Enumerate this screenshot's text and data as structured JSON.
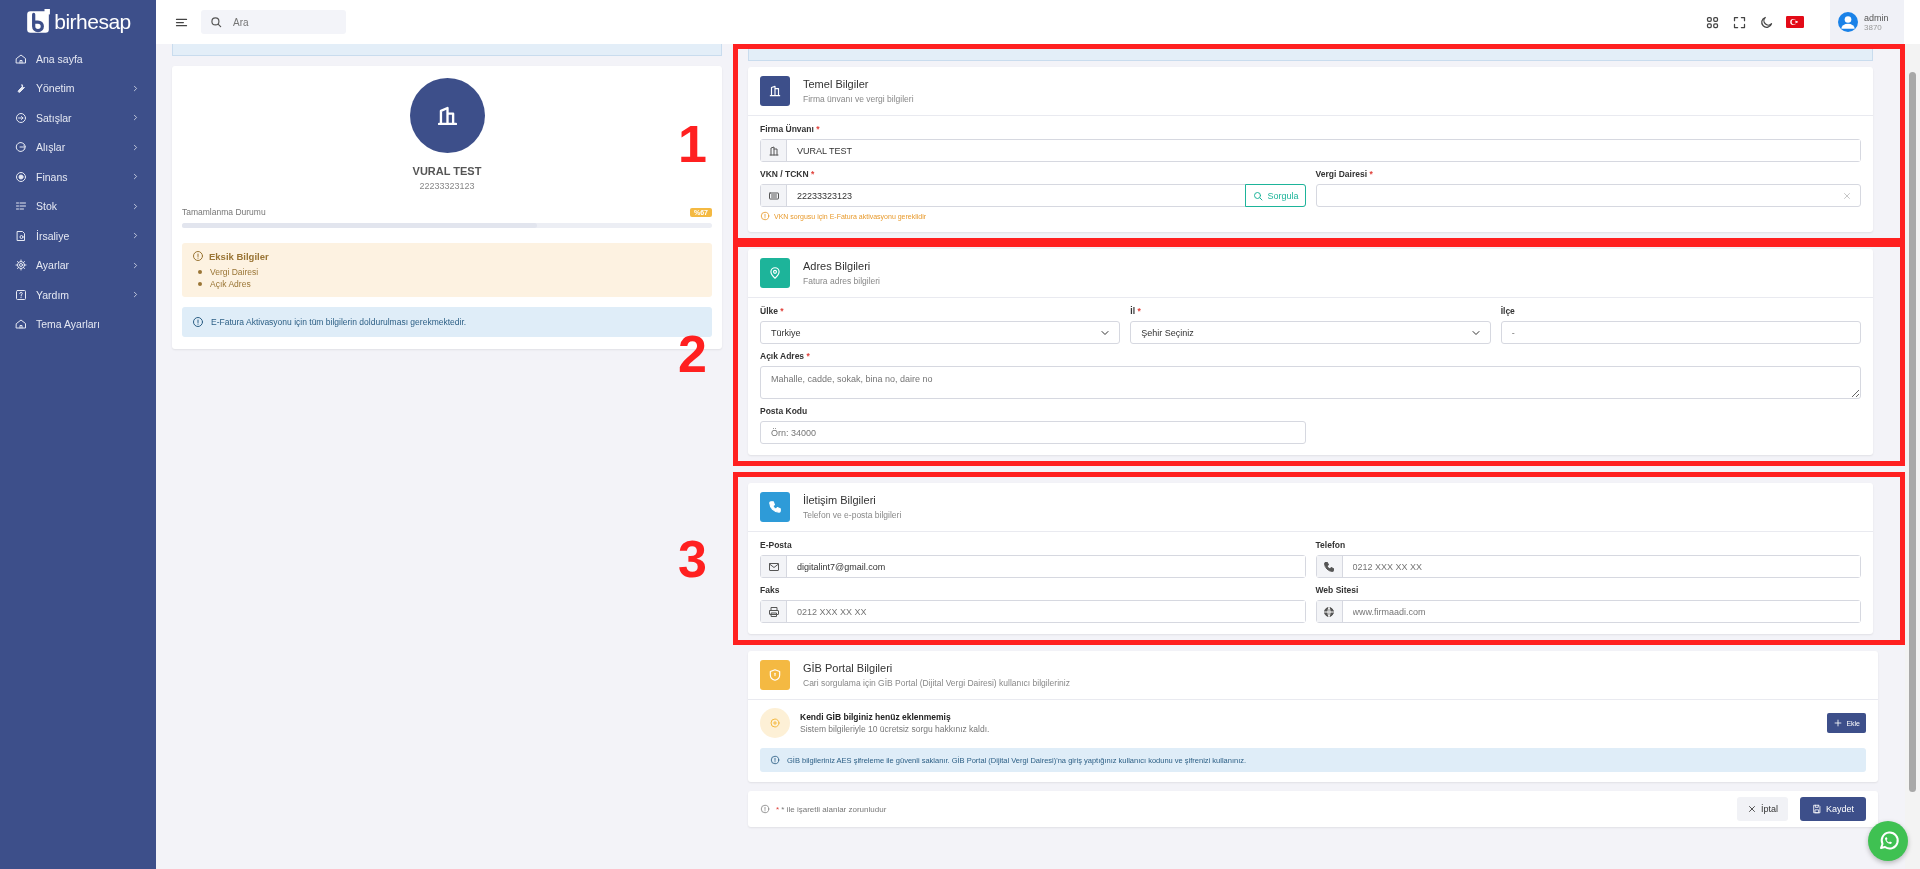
{
  "sidebar": {
    "logo": "birhesap",
    "items": [
      {
        "label": "Ana sayfa",
        "expandable": false
      },
      {
        "label": "Yönetim",
        "expandable": true
      },
      {
        "label": "Satışlar",
        "expandable": true
      },
      {
        "label": "Alışlar",
        "expandable": true
      },
      {
        "label": "Finans",
        "expandable": true
      },
      {
        "label": "Stok",
        "expandable": true
      },
      {
        "label": "İrsaliye",
        "expandable": true
      },
      {
        "label": "Ayarlar",
        "expandable": true
      },
      {
        "label": "Yardım",
        "expandable": true
      },
      {
        "label": "Tema Ayarları",
        "expandable": false
      }
    ]
  },
  "topbar": {
    "search": {
      "placeholder": "Ara"
    },
    "user": {
      "name": "admin",
      "code": "3870"
    }
  },
  "profile": {
    "name": "VURAL TEST",
    "tax_number": "22233323123",
    "completion": {
      "label": "Tamamlanma Durumu",
      "badge": "%67",
      "level": 0.67
    },
    "missing": {
      "title": "Eksik Bilgiler",
      "items": [
        "Vergi Dairesi",
        "Açık Adres"
      ]
    },
    "notice": "E-Fatura Aktivasyonu için tüm bilgilerin doldurulması gerekmektedir."
  },
  "sections": [
    {
      "title": "Temel Bilgiler",
      "subtitle": "Firma ünvanı ve vergi bilgileri",
      "color": "#3d4f8a",
      "annotation": "1",
      "rows": [
        [
          {
            "label": "Firma Ünvanı",
            "required_mark": "*",
            "kind": "icon",
            "value": "VURAL TEST"
          }
        ],
        [
          {
            "label": "VKN / TCKN",
            "required_mark": "*",
            "kind": "query",
            "value": "22233323123",
            "button": "Sorgula",
            "hint": "VKN sorgusu için E-Fatura aktivasyonu gereklidir"
          },
          {
            "label": "Vergi Dairesi",
            "required_mark": "*",
            "kind": "clear"
          }
        ]
      ]
    },
    {
      "title": "Adres Bilgileri",
      "subtitle": "Fatura adres bilgileri",
      "color": "#1db49a",
      "annotation": "2",
      "rows": [
        [
          {
            "label": "Ülke",
            "required_mark": "*",
            "kind": "select",
            "value": "Türkiye"
          },
          {
            "label": "İl",
            "required_mark": "*",
            "kind": "select",
            "value": "Şehir Seçiniz"
          },
          {
            "label": "İlçe",
            "kind": "plain",
            "placeholder": "-"
          }
        ],
        [
          {
            "label": "Açık Adres",
            "required_mark": "*",
            "kind": "textarea",
            "placeholder": "Mahalle, cadde, sokak, bina no, daire no"
          }
        ],
        [
          {
            "label": "Posta Kodu",
            "kind": "plain",
            "placeholder": "Örn: 34000"
          },
          {
            "kind": "spacer"
          }
        ]
      ]
    },
    {
      "title": "İletişim Bilgileri",
      "subtitle": "Telefon ve e-posta bilgileri",
      "color": "#2e9bd8",
      "annotation": "3",
      "rows": [
        [
          {
            "label": "E-Posta",
            "kind": "icon",
            "value": "digitalint7@gmail.com"
          },
          {
            "label": "Telefon",
            "kind": "icon",
            "placeholder": "0212 XXX XX XX"
          }
        ],
        [
          {
            "label": "Faks",
            "kind": "icon",
            "placeholder": "0212 XXX XX XX"
          },
          {
            "label": "Web Sitesi",
            "kind": "icon",
            "placeholder": "www.firmaadi.com"
          }
        ]
      ]
    }
  ],
  "gib": {
    "title": "GİB Portal Bilgileri",
    "subtitle": "Cari sorgulama için GİB Portal (Dijital Vergi Dairesi) kullanıcı bilgileriniz",
    "color": "#f4b942",
    "empty_title": "Kendi GİB bilginiz henüz eklenmemiş",
    "empty_text": "Sistem bilgileriyle 10 ücretsiz sorgu hakkınız kaldı.",
    "add_button": "Ekle",
    "notice": "GİB bilgileriniz AES şifreleme ile güvenli saklanır. GİB Portal (Dijital Vergi Dairesi)'na giriş yaptığınız kullanıcı kodunu ve şifrenizi kullanınız."
  },
  "footer": {
    "mark": "*",
    "note": "* ile işaretli alanlar zorunludur",
    "cancel": "İptal",
    "save": "Kaydet"
  }
}
